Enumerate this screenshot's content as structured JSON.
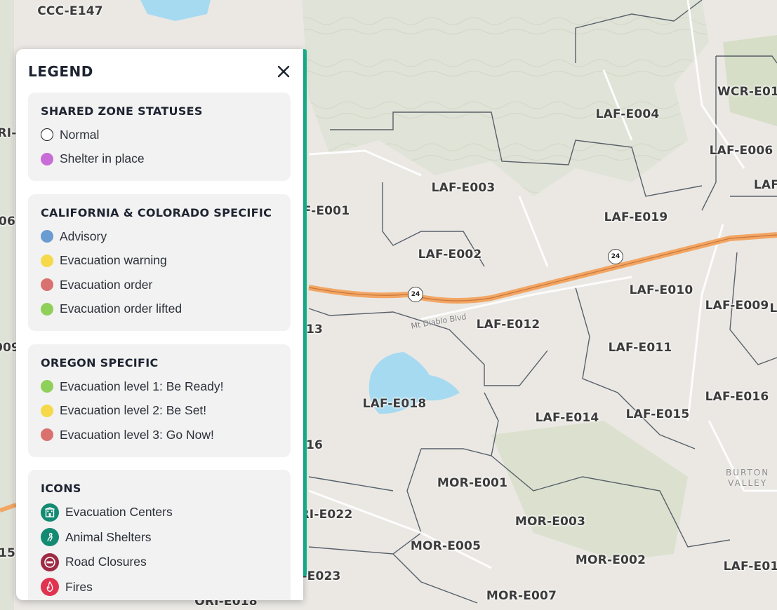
{
  "legend": {
    "title": "LEGEND",
    "sections": [
      {
        "title": "SHARED ZONE STATUSES",
        "items": [
          {
            "label": "Normal",
            "color": "#ffffff",
            "border": "#222222"
          },
          {
            "label": "Shelter in place",
            "color": "#c86dd7"
          }
        ]
      },
      {
        "title": "CALIFORNIA & COLORADO SPECIFIC",
        "items": [
          {
            "label": "Advisory",
            "color": "#6a9bd1"
          },
          {
            "label": "Evacuation warning",
            "color": "#f5d94a"
          },
          {
            "label": "Evacuation order",
            "color": "#d9716f"
          },
          {
            "label": "Evacuation order lifted",
            "color": "#8fd05a"
          }
        ]
      },
      {
        "title": "OREGON SPECIFIC",
        "items": [
          {
            "label": "Evacuation level 1: Be Ready!",
            "color": "#8fd05a"
          },
          {
            "label": "Evacuation level 2: Be Set!",
            "color": "#f5d94a"
          },
          {
            "label": "Evacuation level 3: Go Now!",
            "color": "#d9716f"
          }
        ]
      },
      {
        "title": "ICONS",
        "items": [
          {
            "label": "Evacuation Centers",
            "icon": "evacuation-center-icon",
            "color": "#138a72"
          },
          {
            "label": "Animal Shelters",
            "icon": "animal-shelter-icon",
            "color": "#138a72"
          },
          {
            "label": "Road Closures",
            "icon": "road-closure-icon",
            "color": "#9e2a44"
          },
          {
            "label": "Fires",
            "icon": "fire-icon",
            "color": "#e0334f"
          }
        ]
      }
    ]
  },
  "map": {
    "zones": [
      "CCC-E147",
      "LAF-E004",
      "WCR-E01",
      "LAF-E006",
      "LAF",
      "LAF-E003",
      "LAF-E019",
      "F-E001",
      "LAF-E002",
      "LAF-E010",
      "LAF-E009",
      "L",
      "LAF-E012",
      "LAF-E011",
      "13",
      "LAF-E018",
      "LAF-E016",
      "LAF-E014",
      "LAF-E015",
      "16",
      "MOR-E001",
      "RI-E022",
      "MOR-E003",
      "MOR-E005",
      "MOR-E002",
      "LAF-E01",
      "-E023",
      "MOR-E007",
      "ORI-E018",
      "RI-",
      "06",
      "009",
      "15"
    ],
    "place": "BURTON\nVALLEY",
    "road_name": "Mt Diablo Blvd",
    "highway": "24"
  }
}
